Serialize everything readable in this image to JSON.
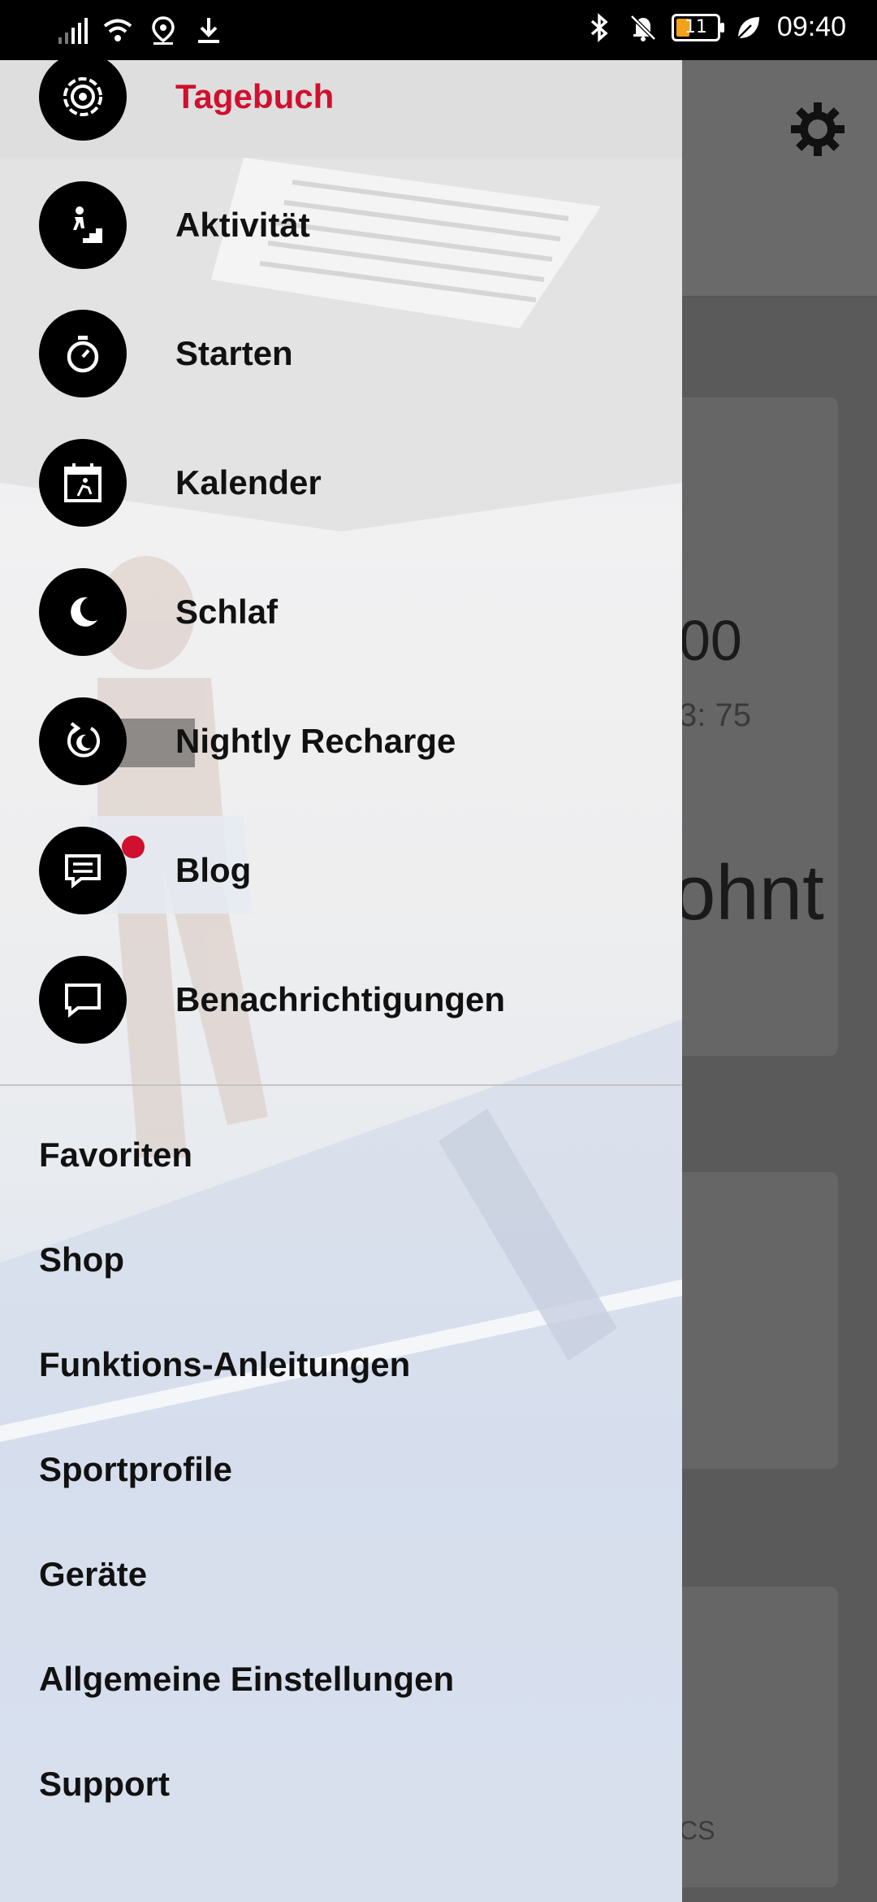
{
  "status_bar": {
    "time": "09:40",
    "battery": "11",
    "left_icons": [
      "signal-icon",
      "wifi-icon",
      "location-icon",
      "download-icon"
    ],
    "right_icons": [
      "bluetooth-icon",
      "bell-off-icon",
      "battery-icon",
      "leaf-icon"
    ]
  },
  "drawer": {
    "main_items": [
      {
        "label": "Tagebuch",
        "icon": "diary-icon",
        "active": true
      },
      {
        "label": "Aktivität",
        "icon": "activity-icon"
      },
      {
        "label": "Starten",
        "icon": "stopwatch-icon"
      },
      {
        "label": "Kalender",
        "icon": "calendar-icon"
      },
      {
        "label": "Schlaf",
        "icon": "moon-icon"
      },
      {
        "label": "Nightly Recharge",
        "icon": "recharge-icon"
      },
      {
        "label": "Blog",
        "icon": "blog-icon",
        "badge": true
      },
      {
        "label": "Benachrichtigungen",
        "icon": "chat-icon"
      }
    ],
    "secondary_items": [
      "Favoriten",
      "Shop",
      "Funktions-Anleitungen",
      "Sportprofile",
      "Geräte",
      "Allgemeine Einstellungen",
      "Support"
    ]
  },
  "background": {
    "value_partial": "00",
    "sub_partial": "3: 75",
    "word_partial": "ohnt",
    "footer_partial": "CS"
  },
  "colors": {
    "accent": "#d0102e",
    "icon_bg": "#000000"
  }
}
